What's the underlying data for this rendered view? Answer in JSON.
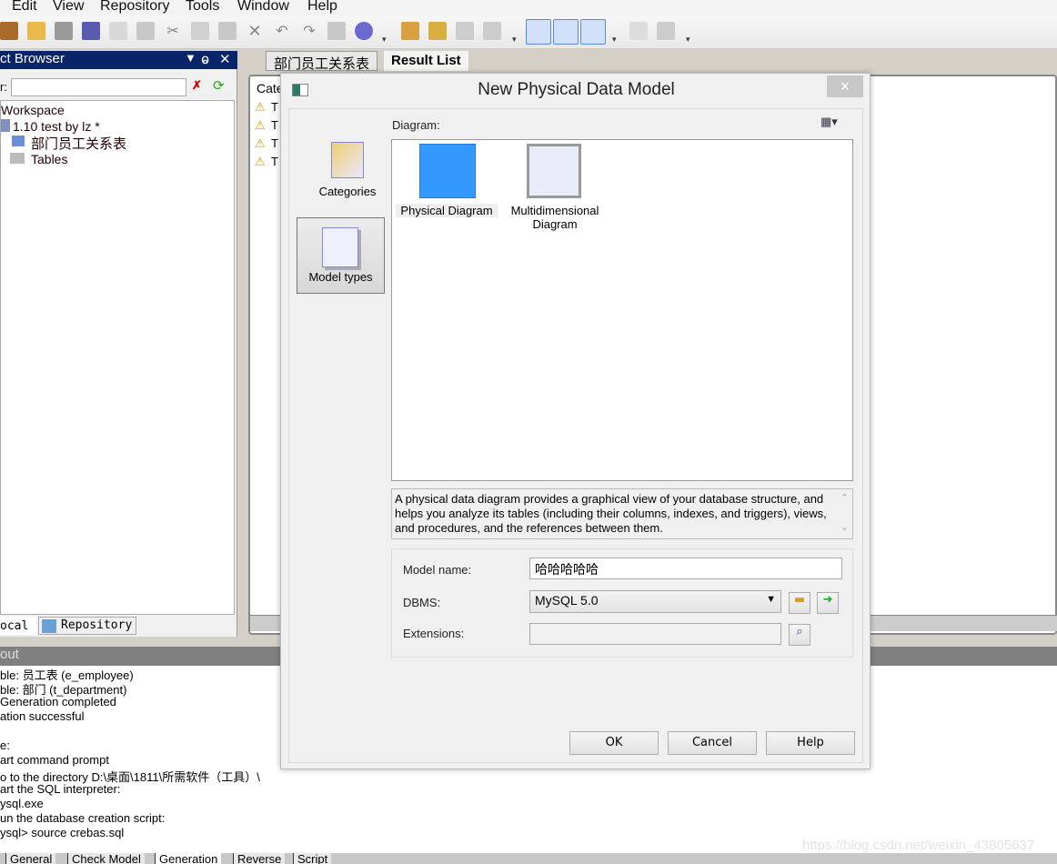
{
  "menu": [
    "Edit",
    "View",
    "Repository",
    "Tools",
    "Window",
    "Help"
  ],
  "browser": {
    "title": "ct Browser",
    "filter_label": "r:",
    "filter_value": "",
    "tree": [
      "Workspace",
      "1.10 test by lz *",
      "部门员工关系表",
      "Tables"
    ],
    "tabs": [
      "ocal",
      "Repository"
    ]
  },
  "right_tabs": [
    "部门员工关系表",
    "Result List"
  ],
  "result": {
    "column": "Cate",
    "rows": [
      "T",
      "T",
      "T",
      "T"
    ]
  },
  "output": {
    "title": "out",
    "lines": [
      "ble: 员工表 (e_employee)",
      "ble: 部门 (t_department)",
      " Generation completed",
      "ation successful",
      "",
      "e:",
      "art command prompt",
      "o to the directory D:\\桌面\\1811\\所需软件（工具）\\",
      "art the SQL interpreter:",
      "ysql.exe",
      "un the database creation script:",
      "ysql> source crebas.sql"
    ],
    "tabs": [
      "General",
      "Check Model",
      "Generation",
      "Reverse",
      "Script"
    ]
  },
  "dialog": {
    "title": "New Physical Data Model",
    "close": "×",
    "categories_label": "Categories",
    "model_types_label": "Model types",
    "diagram_label": "Diagram:",
    "diagrams": [
      {
        "label": "Physical Diagram",
        "selected": true
      },
      {
        "label": "Multidimensional Diagram",
        "selected": false
      }
    ],
    "description": "A physical data diagram provides a graphical view of your database structure, and helps you analyze its tables (including their columns, indexes, and triggers), views, and procedures, and the references between them.",
    "model_name_label": "Model name:",
    "model_name": "哈哈哈哈哈",
    "dbms_label": "DBMS:",
    "dbms": "MySQL 5.0",
    "extensions_label": "Extensions:",
    "extensions": "",
    "ok": "OK",
    "cancel": "Cancel",
    "help": "Help"
  },
  "watermark": "https://blog.csdn.net/weixin_43805637",
  "colors": {
    "title_bar": "#0a246a",
    "selection": "#3399ff"
  }
}
